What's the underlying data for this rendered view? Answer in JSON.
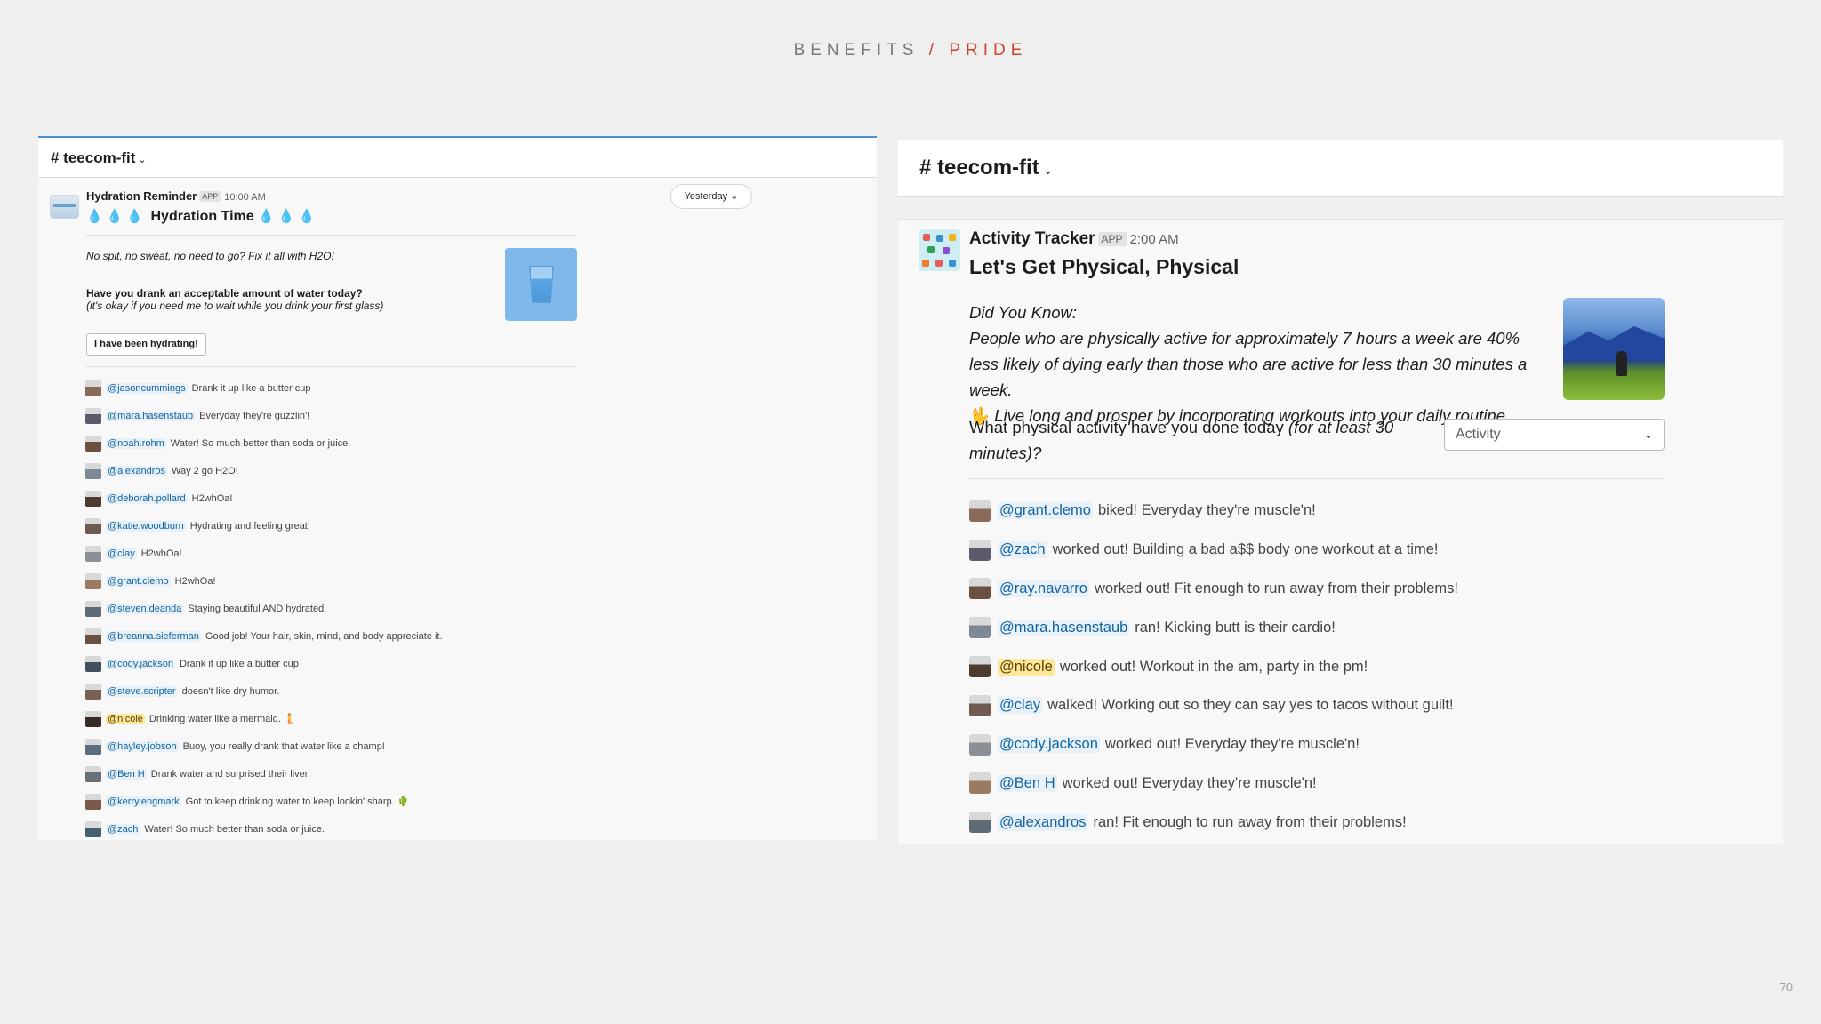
{
  "slide": {
    "title_main": "BENEFITS",
    "title_sep": "/",
    "title_accent": "PRIDE",
    "page_number": "70"
  },
  "colors": {
    "accent": "#d0432b",
    "mention": "#1264a3",
    "mention_bg": "#e8f1f8",
    "mention_highlight_bg": "#fce79a"
  },
  "left": {
    "channel": "# teecom-fit",
    "date_button": "Yesterday",
    "sender": "Hydration Reminder",
    "app_badge": "APP",
    "time": "10:00 AM",
    "headline_drops_left": "💧💧💧",
    "headline": "Hydration Time",
    "headline_drops_right": "💧💧💧",
    "line1": "No spit, no sweat, no need to go? Fix it all with H2O!",
    "question": "Have you drank an acceptable amount of water today?",
    "note": "(it's okay if you need me to wait while you drink your first glass)",
    "button": "I have been hydrating!",
    "replies": [
      {
        "user": "@jasoncummings",
        "text": "Drank it up like a butter cup"
      },
      {
        "user": "@mara.hasenstaub",
        "text": "Everyday they're guzzlin'!"
      },
      {
        "user": "@noah.rohm",
        "text": "Water! So much better than soda or juice."
      },
      {
        "user": "@alexandros",
        "text": "Way 2 go H2O!"
      },
      {
        "user": "@deborah.pollard",
        "text": "H2whOa!"
      },
      {
        "user": "@katie.woodburn",
        "text": "Hydrating and feeling great!"
      },
      {
        "user": "@clay",
        "text": "H2whOa!"
      },
      {
        "user": "@grant.clemo",
        "text": "H2whOa!"
      },
      {
        "user": "@steven.deanda",
        "text": "Staying beautiful AND hydrated."
      },
      {
        "user": "@breanna.sieferman",
        "text": "Good job! Your hair, skin, mind, and body appreciate it."
      },
      {
        "user": "@cody.jackson",
        "text": "Drank it up like a butter cup"
      },
      {
        "user": "@steve.scripter",
        "text": "doesn't like dry humor."
      },
      {
        "user": "@nicole",
        "text": "Drinking water like a mermaid. 🧜"
      },
      {
        "user": "@hayley.jobson",
        "text": "Buoy, you really drank that water like a champ!"
      },
      {
        "user": "@Ben H",
        "text": "Drank water and surprised their liver."
      },
      {
        "user": "@kerry.engmark",
        "text": "Got to keep drinking water to keep lookin' sharp. 🌵"
      },
      {
        "user": "@zach",
        "text": "Water! So much better than soda or juice."
      }
    ]
  },
  "right": {
    "channel": "# teecom-fit",
    "sender": "Activity Tracker",
    "app_badge": "APP",
    "time": "2:00 AM",
    "headline": "Let's Get Physical, Physical",
    "did_you_know": "Did You Know:",
    "fact": "People who are physically active for approximately 7 hours a week are 40% less likely of dying early than those who are active for less than 30 minutes a week.",
    "hand_icon": "🖖",
    "prosper": "Live long and prosper by incorporating workouts into your daily routine.",
    "question_main": "What physical activity have you done today",
    "question_em": "(for at least 30 minutes)?",
    "select_value": "Activity",
    "replies": [
      {
        "user": "@grant.clemo",
        "text": "biked! Everyday they're muscle'n!"
      },
      {
        "user": "@zach",
        "text": "worked out! Building a bad a$$ body one workout at a time!"
      },
      {
        "user": "@ray.navarro",
        "text": "worked out! Fit enough to run away from their problems!"
      },
      {
        "user": "@mara.hasenstaub",
        "text": "ran! Kicking butt is their cardio!"
      },
      {
        "user": "@nicole",
        "text": "worked out! Workout in the am, party in the pm!"
      },
      {
        "user": "@clay",
        "text": "walked! Working out so they can say yes to tacos without guilt!"
      },
      {
        "user": "@cody.jackson",
        "text": "worked out! Everyday they're muscle'n!"
      },
      {
        "user": "@Ben H",
        "text": "worked out! Everyday they're muscle'n!"
      },
      {
        "user": "@alexandros",
        "text": "ran! Fit enough to run away from their problems!"
      }
    ]
  }
}
